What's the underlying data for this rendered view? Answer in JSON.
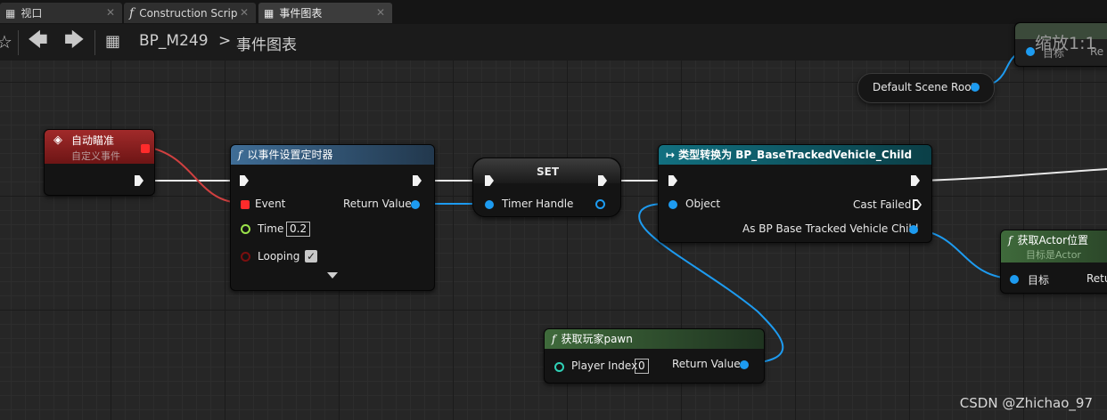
{
  "tabs": [
    {
      "label": "视口"
    },
    {
      "label": "Construction Scrip"
    },
    {
      "label": "事件图表"
    }
  ],
  "breadcrumb": {
    "blueprint": "BP_M249",
    "separator": ">",
    "graph": "事件图表"
  },
  "top_right": {
    "zoom": "缩放1:1",
    "target_label": "目标",
    "cut": "Re"
  },
  "default_scene_root": {
    "label": "Default Scene Root"
  },
  "event_node": {
    "title": "自动瞄准",
    "subtitle": "自定义事件"
  },
  "timer_node": {
    "title": "以事件设置定时器",
    "event_label": "Event",
    "return_label": "Return Value",
    "time_label": "Time",
    "time_value": "0.2",
    "looping_label": "Looping",
    "looping_checked": "✓"
  },
  "set_node": {
    "title": "SET",
    "timer_handle": "Timer Handle"
  },
  "cast_node": {
    "title": "类型转换为 BP_BaseTrackedVehicle_Child",
    "object_label": "Object",
    "cast_failed": "Cast Failed",
    "as_label": "As BP Base Tracked Vehicle Child"
  },
  "location_node": {
    "title": "获取Actor位置",
    "subtitle": "目标是Actor",
    "target_label": "目标",
    "return_cut": "Retur"
  },
  "pawn_node": {
    "title": "获取玩家pawn",
    "player_index_label": "Player Index",
    "player_index_value": "0",
    "return_label": "Return Value"
  },
  "watermark": "CSDN @Zhichao_97",
  "colors": {
    "event_header": "#8b1d1d",
    "function_header": "#3d6c93",
    "cast_header": "#12606a",
    "pure_header": "#3f6a3b",
    "wire_blue": "#1d9bf0",
    "wire_red": "#d04040",
    "wire_exec": "#e8e8e8"
  }
}
